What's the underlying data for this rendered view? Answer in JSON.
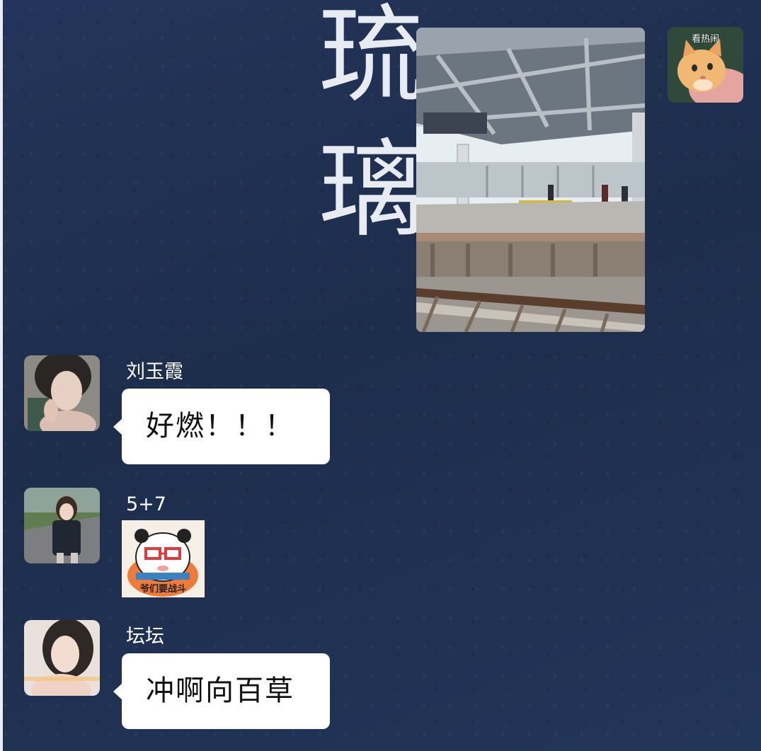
{
  "wallpaper": {
    "glyph_1": "琉",
    "glyph_2": "璃"
  },
  "my_avatar": {
    "sticker_caption": "看热闹"
  },
  "messages": [
    {
      "type": "image",
      "from": "me"
    },
    {
      "type": "text",
      "sender": "刘玉霞",
      "text": "好燃！！！"
    },
    {
      "type": "sticker",
      "sender": "5+7",
      "sticker_caption": "爷们要战斗"
    },
    {
      "type": "text",
      "sender": "坛坛",
      "text": "冲啊向百草"
    }
  ],
  "colors": {
    "background": "#1f3050",
    "bubble": "#ffffff",
    "name_text": "#ffffff",
    "message_text": "#111111"
  }
}
